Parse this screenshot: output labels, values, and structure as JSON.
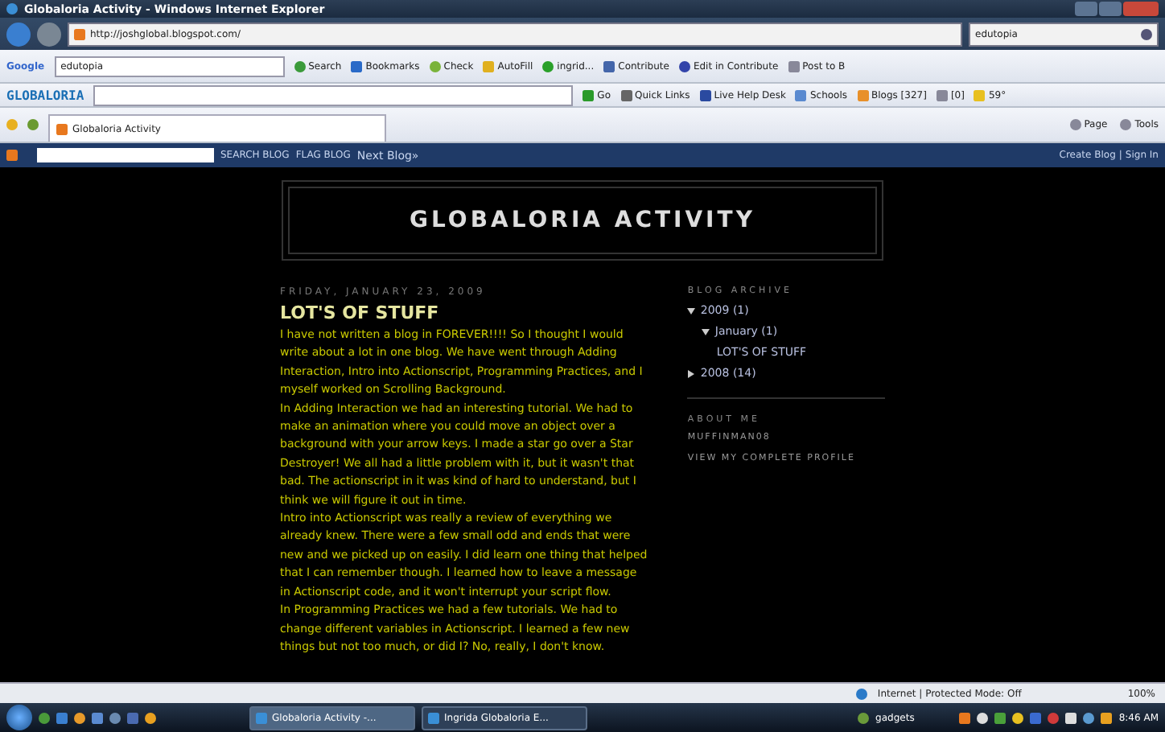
{
  "window": {
    "title": "Globaloria Activity - Windows Internet Explorer"
  },
  "address_bar": {
    "url": "http://joshglobal.blogspot.com/",
    "search_value": "edutopia"
  },
  "google_toolbar": {
    "logo": "Google",
    "query": "edutopia",
    "items": [
      "Search",
      "Bookmarks",
      "Check",
      "AutoFill",
      "ingrid...",
      "Contribute",
      "Edit in Contribute",
      "Post to B"
    ]
  },
  "globaloria_toolbar": {
    "logo": "GLOBALORIA",
    "items": [
      "Go",
      "Quick Links",
      "Live Help Desk",
      "Schools",
      "Blogs [327]",
      "[0]",
      "59°"
    ]
  },
  "tab": {
    "label": "Globaloria Activity"
  },
  "command_bar": [
    "Page",
    "Tools"
  ],
  "blogger_bar": {
    "buttons": [
      "SEARCH BLOG",
      "FLAG BLOG"
    ],
    "next": "Next Blog»",
    "links": [
      "Create Blog",
      "Sign In"
    ],
    "separator": "|"
  },
  "blog": {
    "title": "GLOBALORIA ACTIVITY",
    "post": {
      "date": "FRIDAY, JANUARY 23, 2009",
      "title": "LOT'S OF STUFF",
      "paragraphs": [
        "I have not written a blog in FOREVER!!!! So I thought I would write about a lot in one blog. We have went through Adding Interaction, Intro into Actionscript, Programming Practices, and I myself worked on Scrolling Background.",
        "In Adding Interaction we had an interesting tutorial. We had to make an animation where you could move an object over a background with your arrow keys. I made a star go over a Star Destroyer! We all had a little problem with it, but it wasn't that bad. The actionscript in it was kind of hard to understand, but I think we will figure it out in time.",
        "Intro into Actionscript was really a review of everything we already knew. There were a few small odd and ends that were new and we picked up on easily. I did learn one thing that helped that I can remember though. I learned how to leave a message in Actionscript code, and it won't interrupt your script flow.",
        "In Programming Practices we had a few tutorials. We had to change different variables in Actionscript. I learned a few new things but not too much, or did I? No, really, I don't know."
      ]
    },
    "archive": {
      "heading": "BLOG ARCHIVE",
      "tree": [
        {
          "label": "2009",
          "count": "(1)",
          "expanded": true,
          "children": [
            {
              "label": "January",
              "count": "(1)",
              "expanded": true,
              "children": [
                {
                  "label": "LOT'S OF STUFF"
                }
              ]
            }
          ]
        },
        {
          "label": "2008",
          "count": "(14)",
          "expanded": false
        }
      ]
    },
    "about": {
      "heading": "ABOUT ME",
      "name": "MUFFINMAN08",
      "link": "VIEW MY COMPLETE PROFILE"
    }
  },
  "status_bar": {
    "zone": "Internet | Protected Mode: Off",
    "zoom": "100%"
  },
  "taskbar": {
    "windows": [
      {
        "label": "Globaloria Activity -...",
        "selected": true
      },
      {
        "label": "Ingrida Globaloria E...",
        "selected": false
      }
    ],
    "gadgets": "gadgets",
    "time": "8:46 AM"
  }
}
